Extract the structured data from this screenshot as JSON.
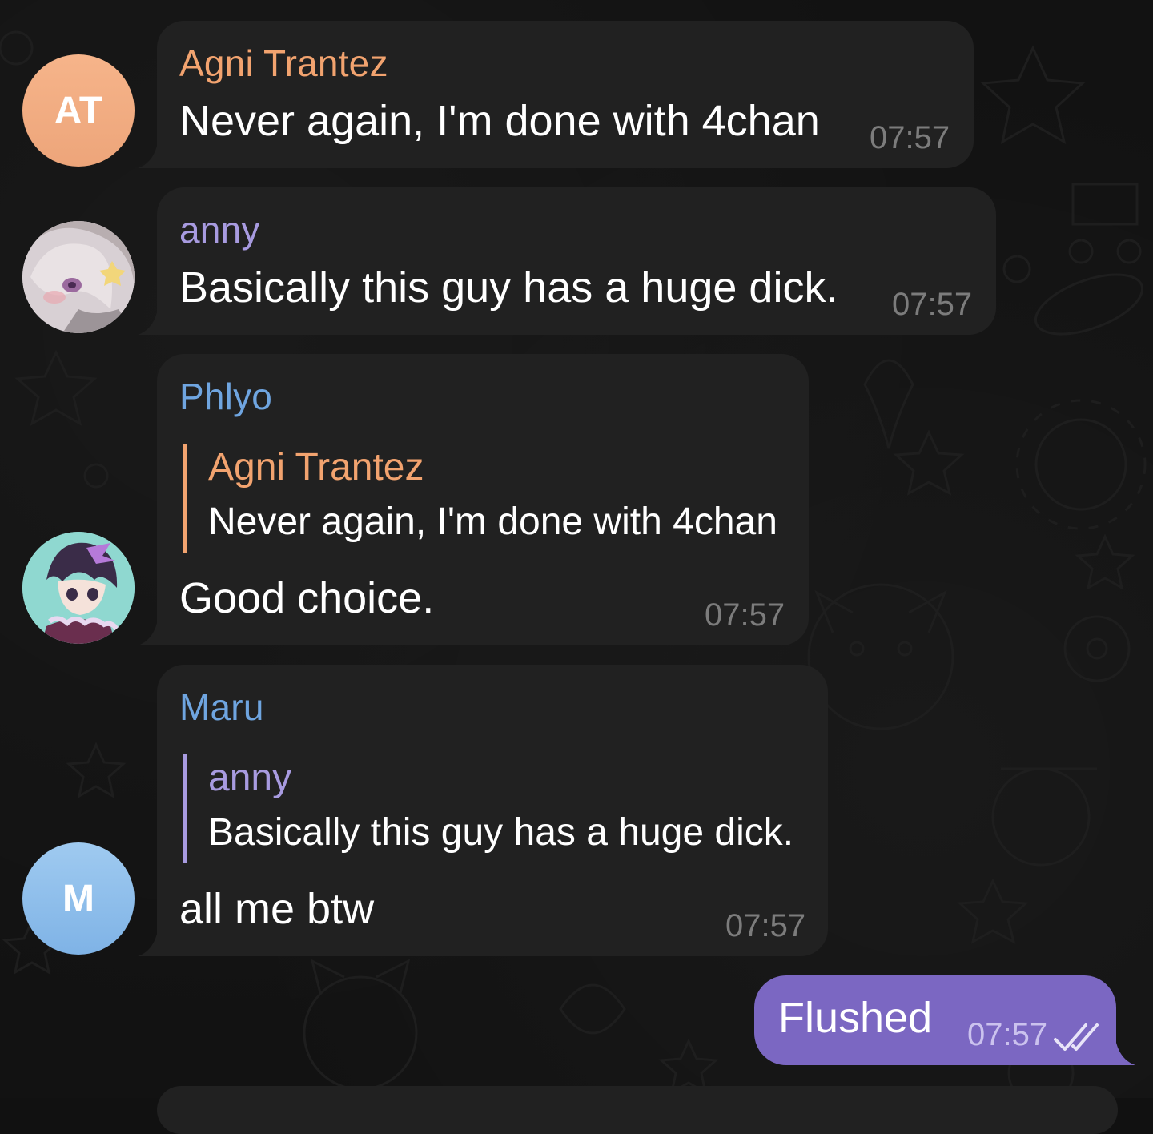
{
  "colors": {
    "background": "#121212",
    "bubble_incoming": "#212121",
    "bubble_outgoing": "#7b67c2",
    "time_gray": "#7c7c7c",
    "name_orange": "#f2a36f",
    "name_violet": "#a89be0",
    "name_blue": "#6fa5e0"
  },
  "messages": [
    {
      "sender": "Agni Trantez",
      "sender_color": "#f2a36f",
      "avatar_initials": "AT",
      "text": "Never again, I'm done with 4chan",
      "time": "07:57"
    },
    {
      "sender": "anny",
      "sender_color": "#a89be0",
      "avatar_icon": "anime-girl-avatar-icon",
      "text": "Basically this guy has a huge dick.",
      "time": "07:57"
    },
    {
      "sender": "Phlyo",
      "sender_color": "#6fa5e0",
      "avatar_icon": "anime-boy-avatar-icon",
      "reply_to": {
        "sender": "Agni Trantez",
        "text": "Never again, I'm done with 4chan"
      },
      "text": "Good choice.",
      "time": "07:57"
    },
    {
      "sender": "Maru",
      "sender_color": "#6fa5e0",
      "avatar_initials": "M",
      "reply_to": {
        "sender": "anny",
        "text": "Basically this guy has a huge dick."
      },
      "text": "all me btw",
      "time": "07:57"
    }
  ],
  "outgoing": {
    "text": "Flushed",
    "time": "07:57",
    "status_icon": "double-check-icon"
  }
}
